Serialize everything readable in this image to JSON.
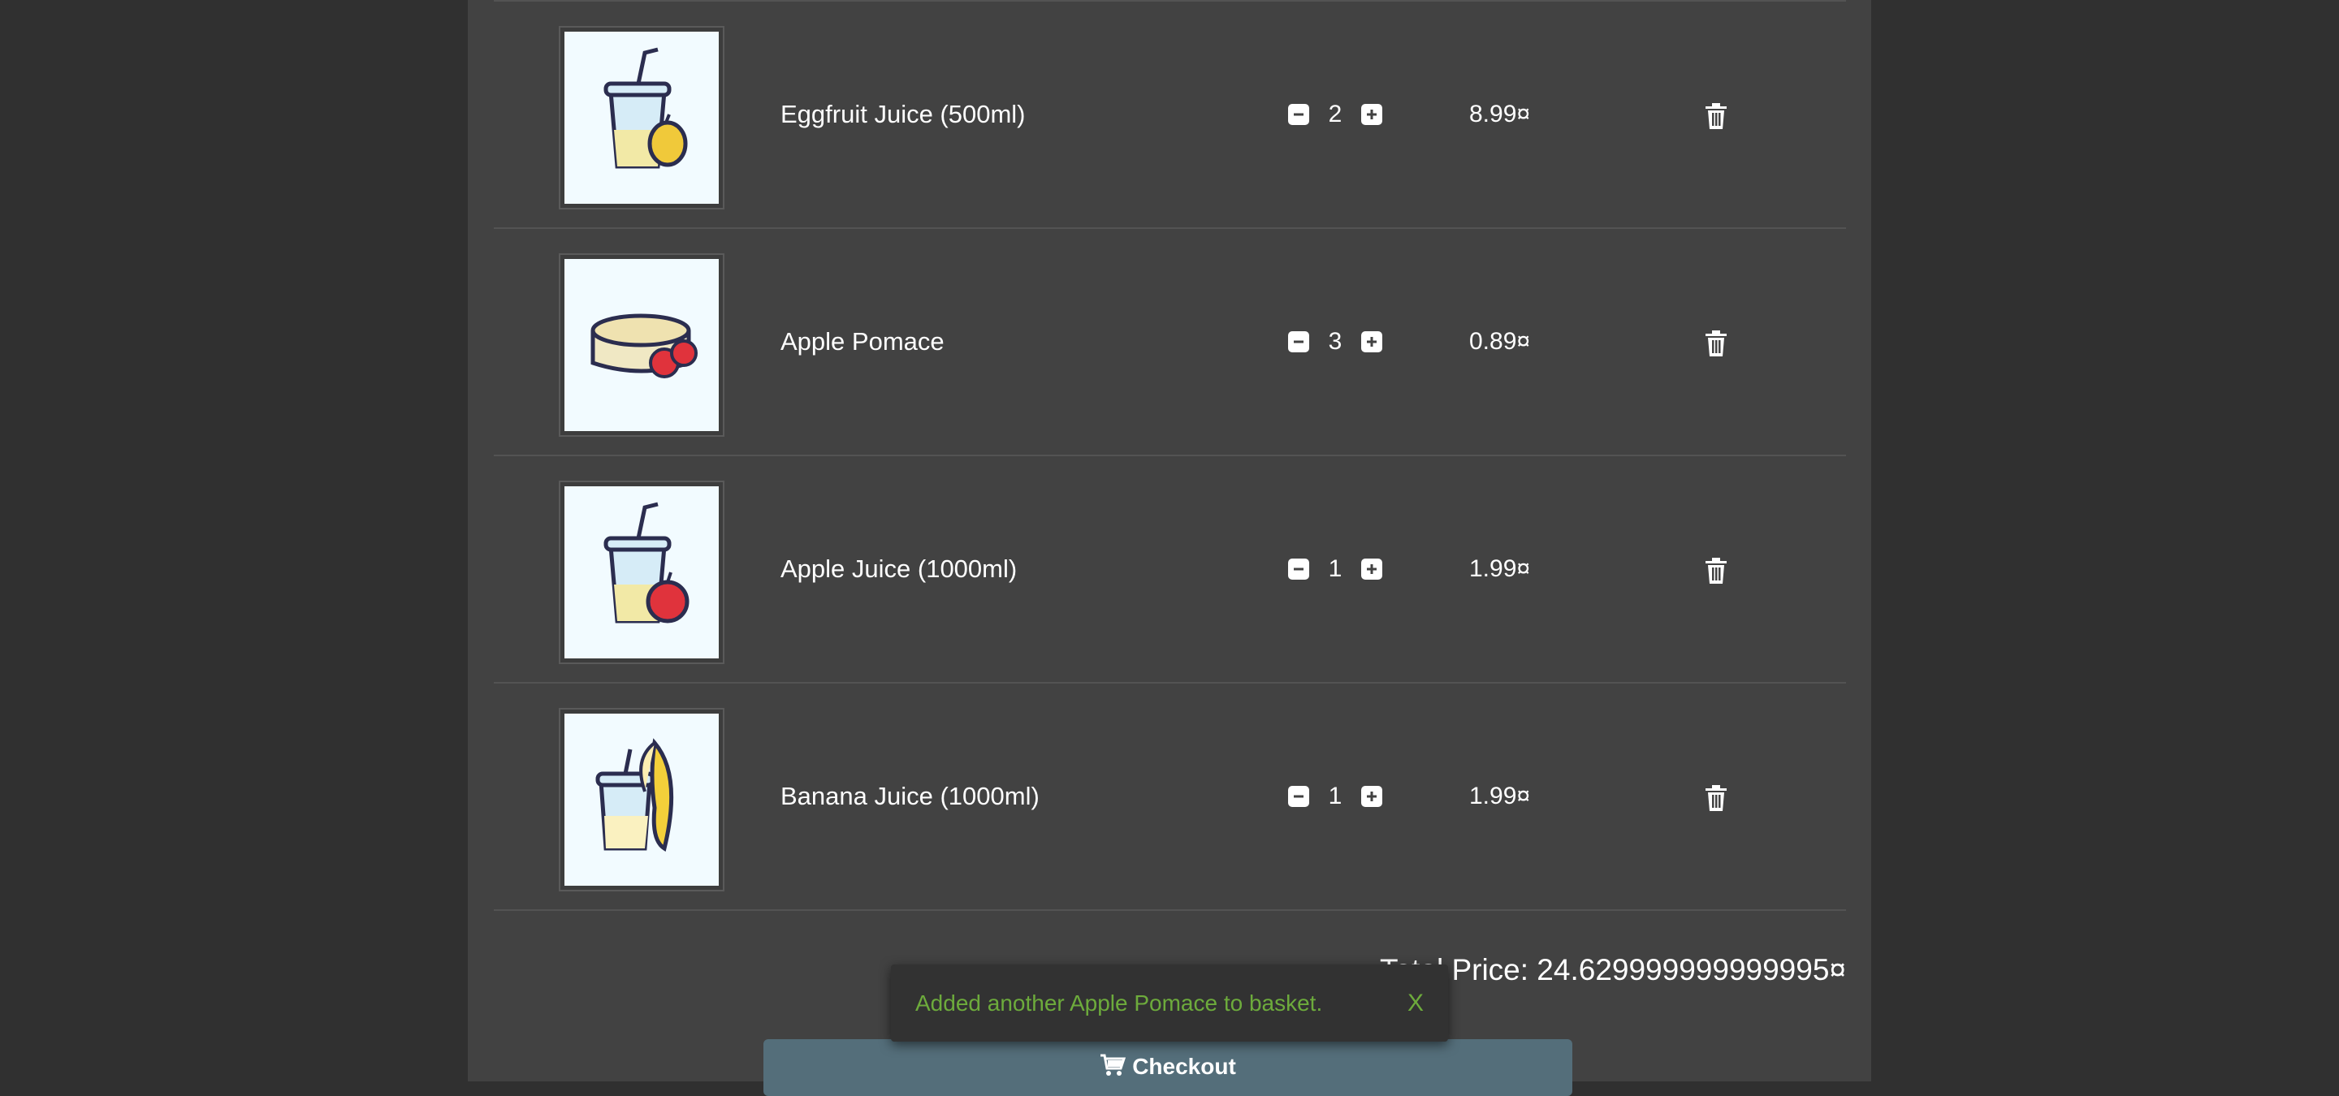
{
  "basket": {
    "items": [
      {
        "name": "Eggfruit Juice (500ml)",
        "quantity": "2",
        "price": "8.99¤",
        "image_icon": "eggfruit-juice-image"
      },
      {
        "name": "Apple Pomace",
        "quantity": "3",
        "price": "0.89¤",
        "image_icon": "apple-pomace-image"
      },
      {
        "name": "Apple Juice (1000ml)",
        "quantity": "1",
        "price": "1.99¤",
        "image_icon": "apple-juice-image"
      },
      {
        "name": "Banana Juice (1000ml)",
        "quantity": "1",
        "price": "1.99¤",
        "image_icon": "banana-juice-image"
      }
    ],
    "total_price": "Total Price: 24.629999999999995¤",
    "checkout_label": "Checkout"
  },
  "toast": {
    "message": "Added another Apple Pomace to basket.",
    "close_label": "X"
  },
  "colors": {
    "background": "#303030",
    "panel": "#424242",
    "checkout_button": "#546e7a",
    "toast_text": "#6dab3c"
  }
}
